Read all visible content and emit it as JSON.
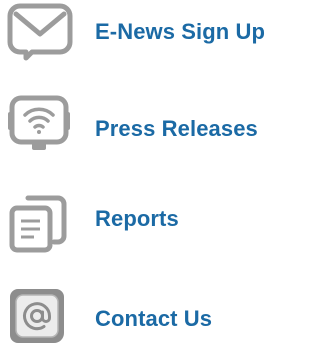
{
  "theme": {
    "link_color": "#1b6aa5",
    "icon_color": "#9c9c9c"
  },
  "nav": {
    "items": [
      {
        "label": "E-News Sign Up",
        "icon": "envelope-icon"
      },
      {
        "label": "Press Releases",
        "icon": "wifi-broadcast-icon"
      },
      {
        "label": "Reports",
        "icon": "documents-icon"
      },
      {
        "label": "Contact Us",
        "icon": "at-sign-icon"
      }
    ]
  }
}
